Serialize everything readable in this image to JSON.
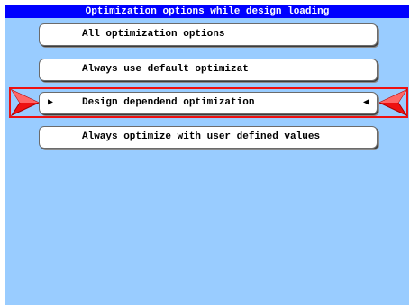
{
  "screen": {
    "title": "Optimization options while design loading",
    "background_color": "#99ccff",
    "title_bar_color": "#0000ff",
    "highlight_color": "#ee1111"
  },
  "options": [
    {
      "label": "All optimization options",
      "selected": false
    },
    {
      "label": "Always use default optimizat",
      "selected": false
    },
    {
      "label": "Design dependend optimization",
      "selected": true
    },
    {
      "label": "Always optimize with user defined values",
      "selected": false
    }
  ],
  "indicators": {
    "left_marker": "▶",
    "right_marker": "◀",
    "left_pointer_icon": "red-pointer-right-icon",
    "right_pointer_icon": "red-pointer-left-icon"
  }
}
